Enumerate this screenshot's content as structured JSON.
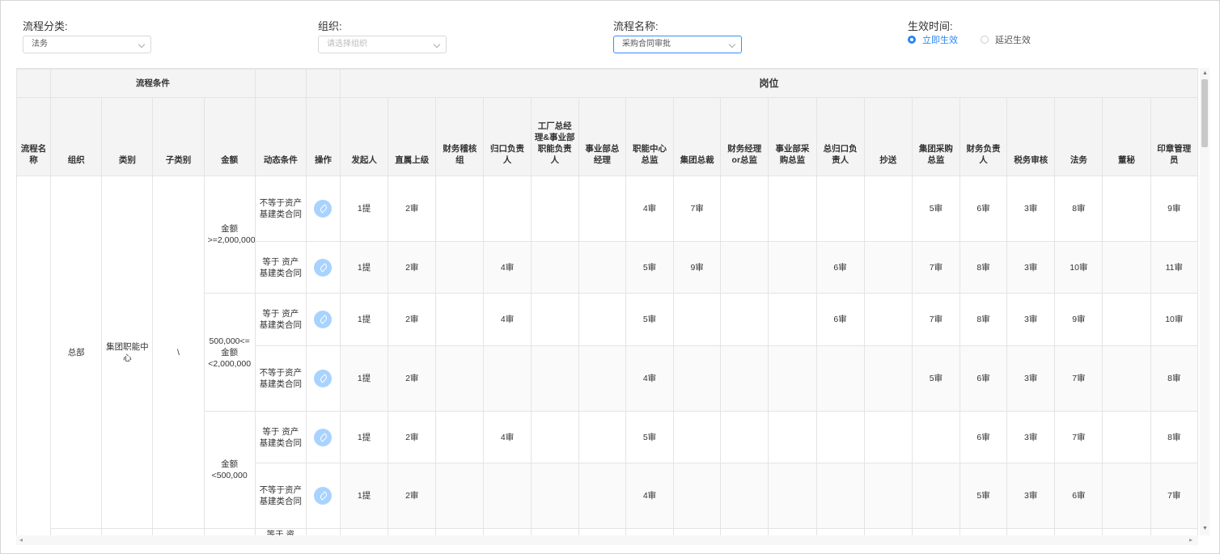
{
  "filters": {
    "category": {
      "label": "流程分类:",
      "value": "法务"
    },
    "org": {
      "label": "组织:",
      "placeholder": "请选择组织"
    },
    "process": {
      "label": "流程名称:",
      "value": "采购合同审批"
    },
    "effective": {
      "label": "生效时间:",
      "options": [
        "立即生效",
        "延迟生效"
      ],
      "selected": "立即生效"
    }
  },
  "colors": {
    "accent": "#2b86f0",
    "edit_icon": "#a9d3ff"
  },
  "table": {
    "group_headers": {
      "condition": "流程条件",
      "positions": "岗位"
    },
    "condition_columns": [
      "流程名称",
      "组织",
      "类别",
      "子类别",
      "金额",
      "动态条件",
      "操作"
    ],
    "position_columns": [
      "发起人",
      "直属上级",
      "财务稽核组",
      "归口负责人",
      "工厂总经理&事业部职能负责人",
      "事业部总经理",
      "职能中心总监",
      "集团总裁",
      "财务经理or总监",
      "事业部采购总监",
      "总归口负责人",
      "抄送",
      "集团采购总监",
      "财务负责人",
      "税务审核",
      "法务",
      "董秘",
      "印章管理员"
    ],
    "merged": {
      "org": "总部",
      "category": "集团职能中心",
      "subcategory": "\\"
    },
    "amount_groups": [
      "金额>=2,000,000",
      "500,000<=金额<2,000,000",
      "金额<500,000"
    ],
    "rows": [
      {
        "dynamic": "不等于资产基建类合同",
        "cells": [
          "1提",
          "2审",
          "",
          "",
          "",
          "",
          "4审",
          "7审",
          "",
          "",
          "",
          "",
          "5审",
          "6审",
          "3审",
          "8审",
          "",
          "9审"
        ]
      },
      {
        "dynamic": "等于 资产基建类合同",
        "cells": [
          "1提",
          "2审",
          "",
          "4审",
          "",
          "",
          "5审",
          "9审",
          "",
          "",
          "6审",
          "",
          "7审",
          "8审",
          "3审",
          "10审",
          "",
          "11审"
        ]
      },
      {
        "dynamic": "等于 资产基建类合同",
        "cells": [
          "1提",
          "2审",
          "",
          "4审",
          "",
          "",
          "5审",
          "",
          "",
          "",
          "6审",
          "",
          "7审",
          "8审",
          "3审",
          "9审",
          "",
          "10审"
        ]
      },
      {
        "dynamic": "不等于资产基建类合同",
        "cells": [
          "1提",
          "2审",
          "",
          "",
          "",
          "",
          "4审",
          "",
          "",
          "",
          "",
          "",
          "5审",
          "6审",
          "3审",
          "7审",
          "",
          "8审"
        ]
      },
      {
        "dynamic": "等于 资产基建类合同",
        "cells": [
          "1提",
          "2审",
          "",
          "4审",
          "",
          "",
          "5审",
          "",
          "",
          "",
          "",
          "",
          "",
          "6审",
          "3审",
          "7审",
          "",
          "8审"
        ]
      },
      {
        "dynamic": "不等于资产基建类合同",
        "cells": [
          "1提",
          "2审",
          "",
          "",
          "",
          "",
          "4审",
          "",
          "",
          "",
          "",
          "",
          "",
          "5审",
          "3审",
          "6审",
          "",
          "7审"
        ]
      }
    ],
    "partial_row_dynamic": "等于 资"
  }
}
